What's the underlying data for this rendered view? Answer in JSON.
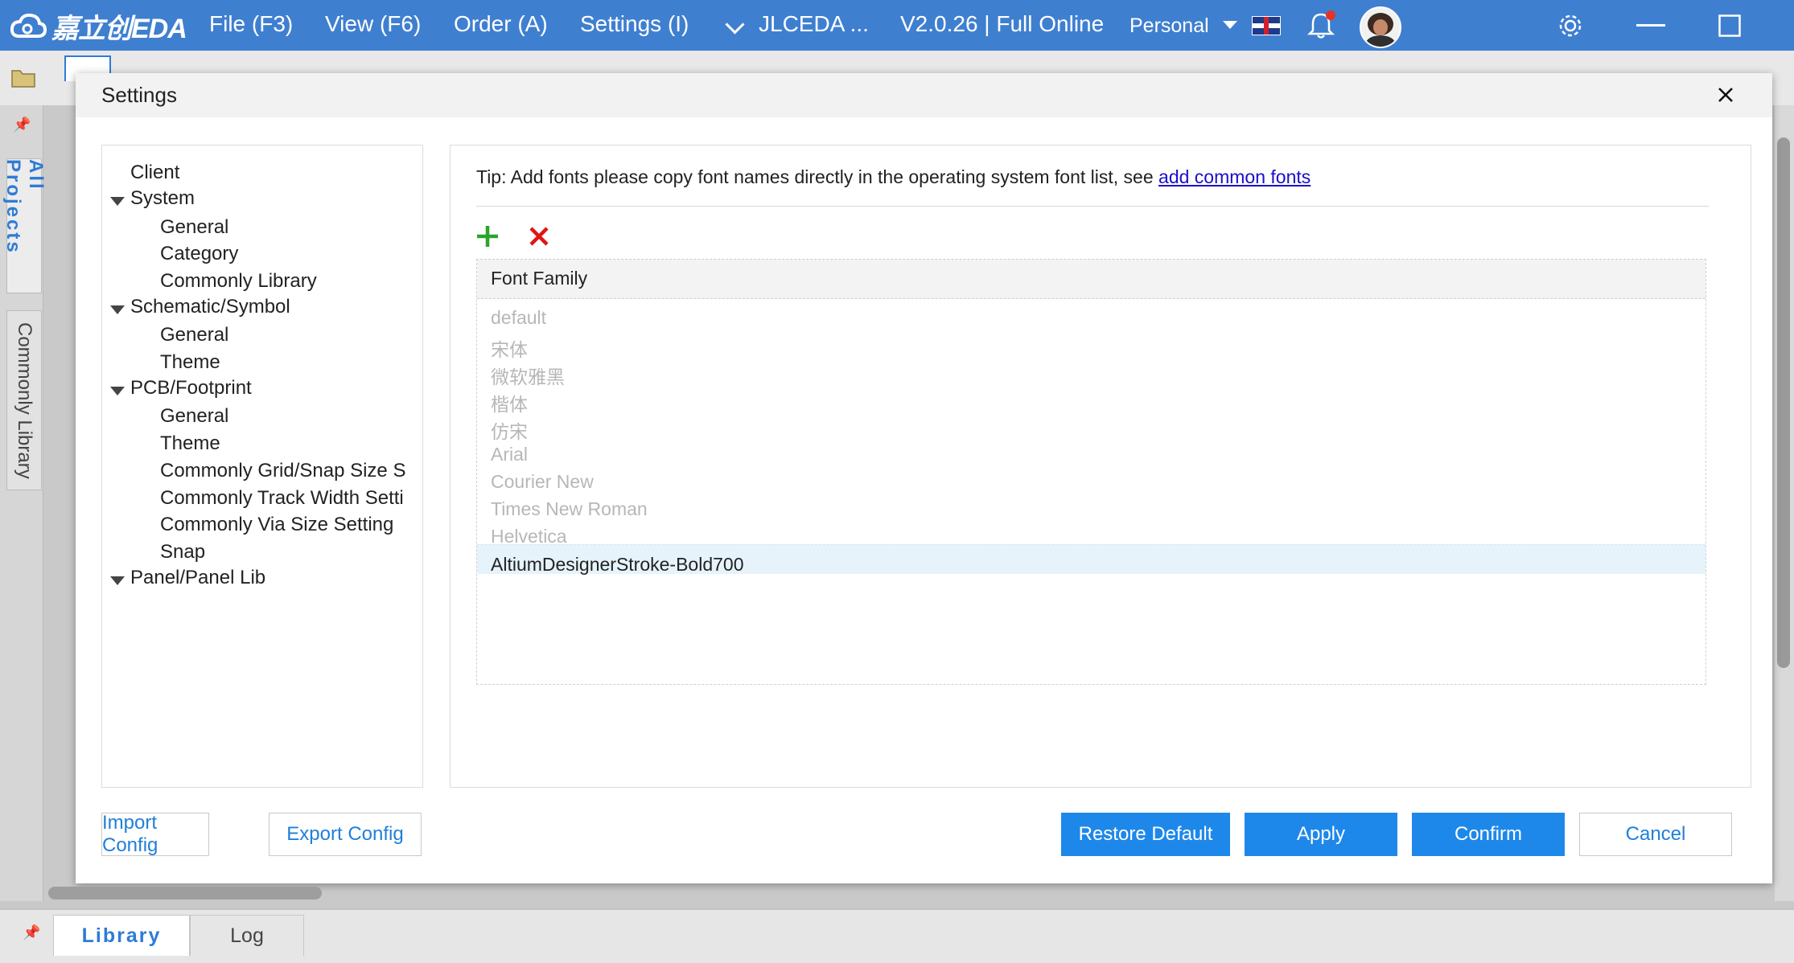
{
  "topbar": {
    "logo_text": "嘉立创EDA",
    "menu": [
      "File (F3)",
      "View (F6)",
      "Order (A)",
      "Settings (I)"
    ],
    "project": "JLCEDA ...",
    "version": "V2.0.26 | Full Online",
    "plan": "Personal"
  },
  "left_tabs": {
    "all_projects": "All Projects",
    "commonly_library": "Commonly Library"
  },
  "bottom_tabs": {
    "library": "Library",
    "log": "Log"
  },
  "dialog": {
    "title": "Settings",
    "tree": [
      {
        "label": "Client"
      },
      {
        "label": "System"
      },
      {
        "label": "General"
      },
      {
        "label": "Category"
      },
      {
        "label": "Commonly Library"
      },
      {
        "label": "Schematic/Symbol"
      },
      {
        "label": "General"
      },
      {
        "label": "Theme"
      },
      {
        "label": "PCB/Footprint"
      },
      {
        "label": "General"
      },
      {
        "label": "Theme"
      },
      {
        "label": "Commonly Grid/Snap Size S"
      },
      {
        "label": "Commonly Track Width Setti"
      },
      {
        "label": "Commonly Via Size Setting"
      },
      {
        "label": "Snap"
      },
      {
        "label": "Panel/Panel Lib"
      }
    ],
    "tip_text": "Tip: Add fonts please copy font names directly in the operating system font list, see ",
    "tip_link": "add common fonts",
    "table": {
      "header": "Font Family",
      "rows": [
        "default",
        "宋体",
        "微软雅黑",
        "楷体",
        "仿宋",
        "Arial",
        "Courier New",
        "Times New Roman",
        "Helvetica",
        "AltiumDesignerStroke-Bold700"
      ],
      "selected_row": "AltiumDesignerStroke-Bold700"
    },
    "buttons": {
      "import": "Import Config",
      "export": "Export Config",
      "restore": "Restore Default",
      "apply": "Apply",
      "confirm": "Confirm",
      "cancel": "Cancel"
    }
  },
  "colors": {
    "brand_blue": "#3f7fd0",
    "primary_button": "#1e88ea",
    "link": "#1a0dcc",
    "add_green": "#2aa52a",
    "delete_red": "#e01515"
  }
}
